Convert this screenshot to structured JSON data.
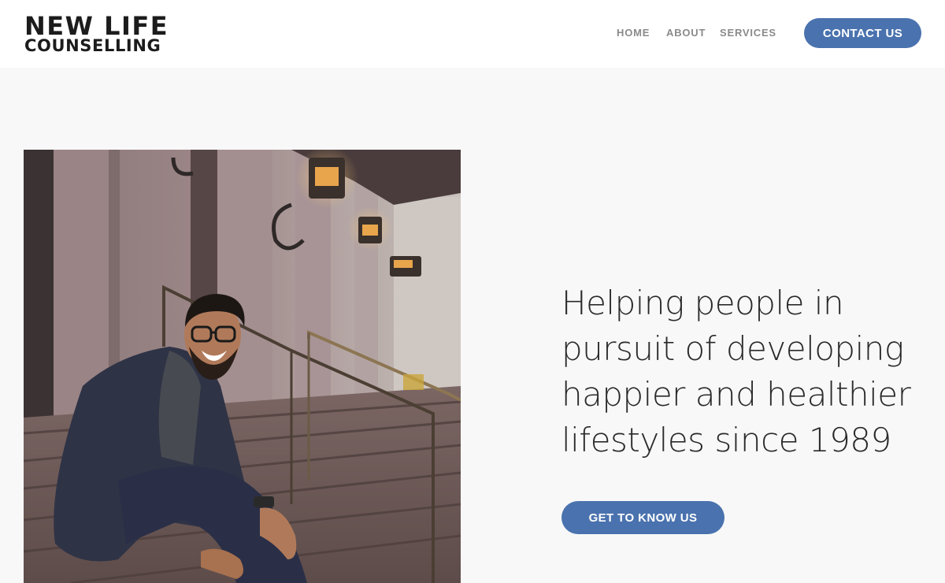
{
  "brand": {
    "name_line1": "NEW LIFE",
    "name_line2": "COUNSELLING"
  },
  "nav": {
    "items": [
      "HOME",
      "ABOUT",
      "SERVICES"
    ],
    "cta_label": "CONTACT US"
  },
  "hero": {
    "headline_lines": [
      "Helping people in",
      "pursuit of developing",
      "happier and healthier",
      "lifestyles since 1989"
    ],
    "cta_label": "GET TO KNOW US",
    "image_alt": "smiling man sitting on stone steps"
  },
  "colors": {
    "accent": "#4a72ae",
    "page_bg": "#f8f8f8",
    "header_bg": "#ffffff",
    "text_dark": "#1c1c1c",
    "nav_text": "#8a8a8a"
  }
}
